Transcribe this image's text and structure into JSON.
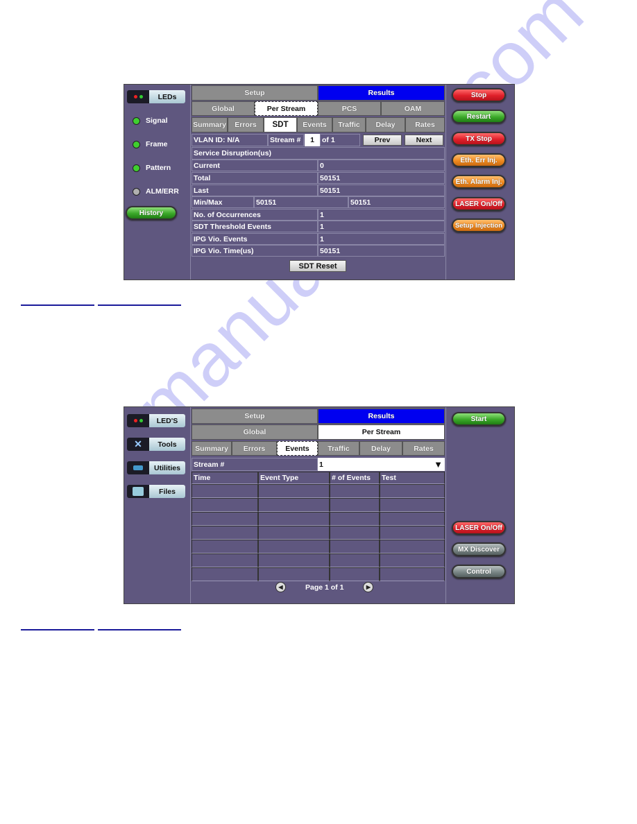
{
  "watermark": "manualshive.com",
  "screen1": {
    "left": {
      "leds_label": "LEDs",
      "leds": [
        {
          "label": "Signal",
          "color": "#3fcf2f"
        },
        {
          "label": "Frame",
          "color": "#3fcf2f"
        },
        {
          "label": "Pattern",
          "color": "#3fcf2f"
        },
        {
          "label": "ALM/ERR",
          "color": "#b0b0b0"
        }
      ],
      "history_label": "History"
    },
    "top_tabs": [
      "Setup",
      "Results"
    ],
    "sub_tabs": [
      "Global",
      "Per Stream",
      "PCS",
      "OAM"
    ],
    "result_tabs": [
      "Summary",
      "Errors",
      "SDT",
      "Events",
      "Traffic",
      "Delay",
      "Rates"
    ],
    "vlan": "VLAN ID: N/A",
    "stream_label": "Stream #",
    "stream_value": "1",
    "stream_of": "of 1",
    "prev": "Prev",
    "next": "Next",
    "section": "Service Disruption(us)",
    "rows": [
      {
        "label": "Current",
        "value": "0"
      },
      {
        "label": "Total",
        "value": "50151"
      },
      {
        "label": "Last",
        "value": "50151"
      }
    ],
    "minmax": {
      "label": "Min/Max",
      "min": "50151",
      "max": "50151"
    },
    "rows2": [
      {
        "label": "No. of Occurrences",
        "value": "1"
      },
      {
        "label": "SDT Threshold Events",
        "value": "1"
      },
      {
        "label": "IPG Vio. Events",
        "value": "1"
      },
      {
        "label": "IPG Vio. Time(us)",
        "value": "50151"
      }
    ],
    "reset": "SDT Reset",
    "right_buttons": [
      "Stop",
      "Restart",
      "TX Stop",
      "Eth. Err Inj.",
      "Eth. Alarm Inj.",
      "LASER On/Off",
      "Setup Injection"
    ]
  },
  "screen2": {
    "left": {
      "buttons": [
        "LED'S",
        "Tools",
        "Utilities",
        "Files"
      ]
    },
    "top_tabs": [
      "Setup",
      "Results"
    ],
    "sub_tabs": [
      "Global",
      "Per Stream"
    ],
    "result_tabs": [
      "Summary",
      "Errors",
      "Events",
      "Traffic",
      "Delay",
      "Rates"
    ],
    "stream_label": "Stream #",
    "stream_value": "1",
    "columns": [
      "Time",
      "Event Type",
      "# of Events",
      "Test"
    ],
    "page": "Page 1 of 1",
    "right_buttons": [
      "Start",
      "LASER On/Off",
      "MX Discover",
      "Control"
    ]
  }
}
